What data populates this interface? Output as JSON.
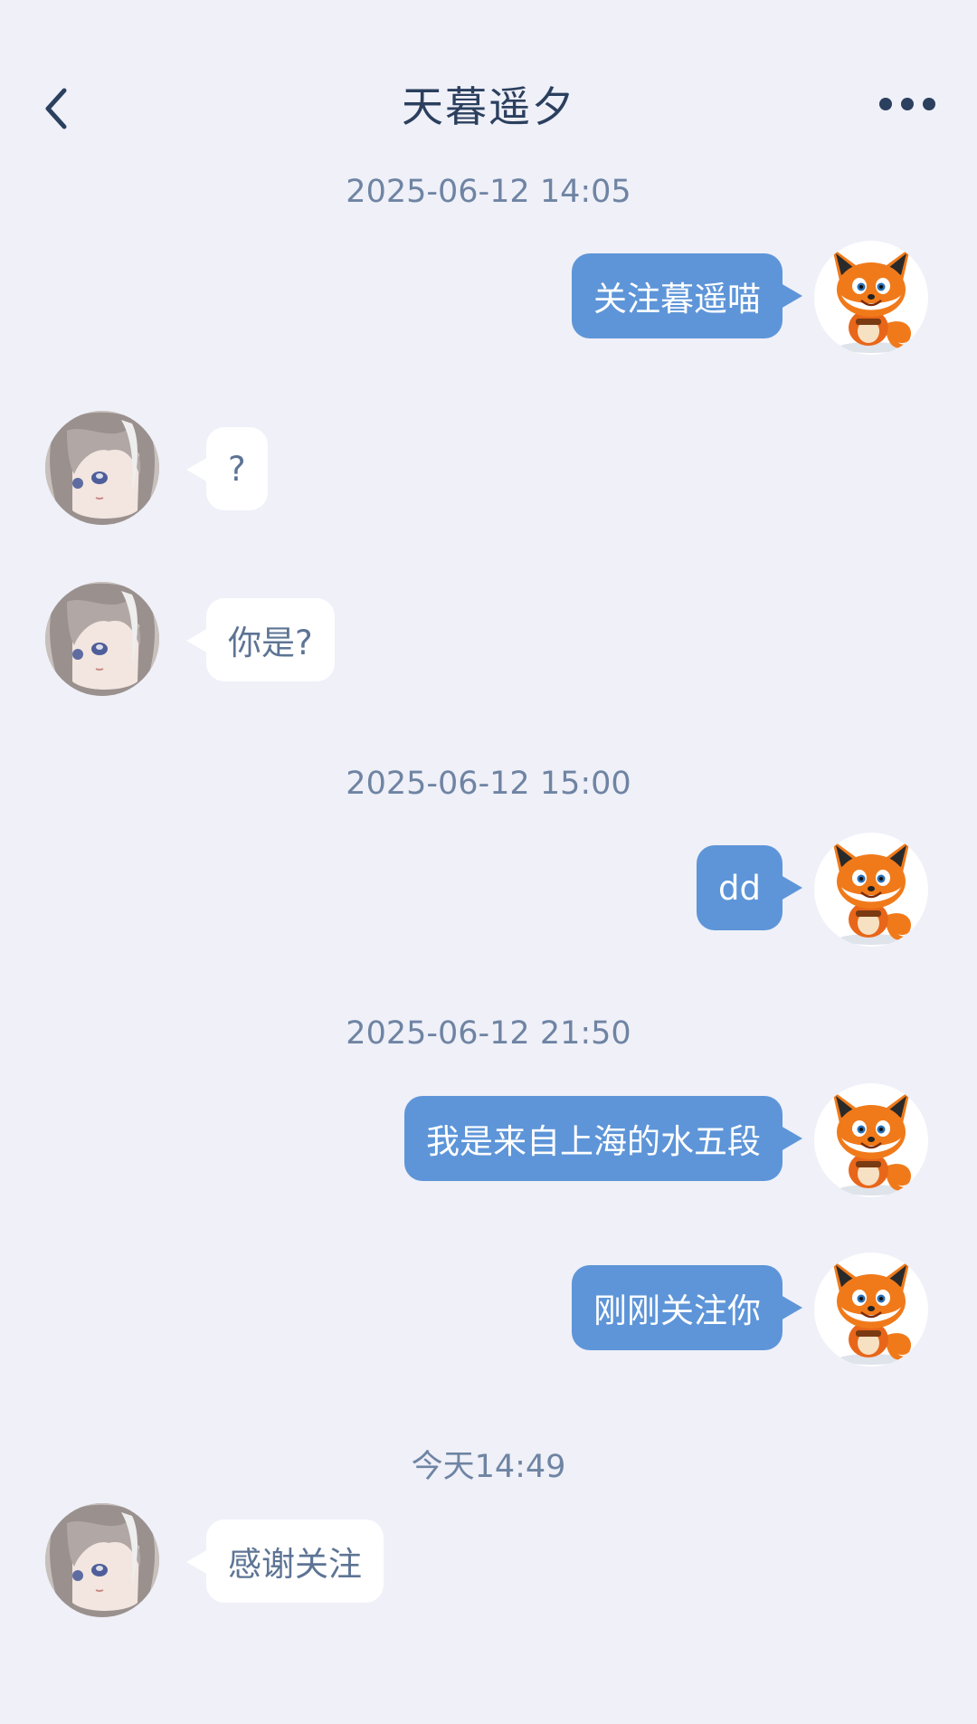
{
  "header": {
    "title": "天暮遥夕",
    "back_icon": "chevron-left-icon",
    "more_icon": "more-horizontal-icon"
  },
  "colors": {
    "background": "#eff0f8",
    "sent_bubble": "#5e95d8",
    "received_bubble": "#ffffff",
    "title_text": "#2b3f5e",
    "timestamp_text": "#6f84a3"
  },
  "conversation": {
    "timestamps": [
      "2025-06-12  14:05",
      "2025-06-12  15:00",
      "2025-06-12  21:50",
      "今天14:49"
    ],
    "messages": [
      {
        "from": "me",
        "text": "关注暮遥喵",
        "avatar": "fox-avatar"
      },
      {
        "from": "her",
        "text": "?",
        "avatar": "anime-girl-avatar"
      },
      {
        "from": "her",
        "text": "你是?",
        "avatar": "anime-girl-avatar"
      },
      {
        "from": "me",
        "text": "dd",
        "avatar": "fox-avatar"
      },
      {
        "from": "me",
        "text": "我是来自上海的水五段",
        "avatar": "fox-avatar"
      },
      {
        "from": "me",
        "text": "刚刚关注你",
        "avatar": "fox-avatar"
      },
      {
        "from": "her",
        "text": "感谢关注",
        "avatar": "anime-girl-avatar"
      }
    ]
  }
}
